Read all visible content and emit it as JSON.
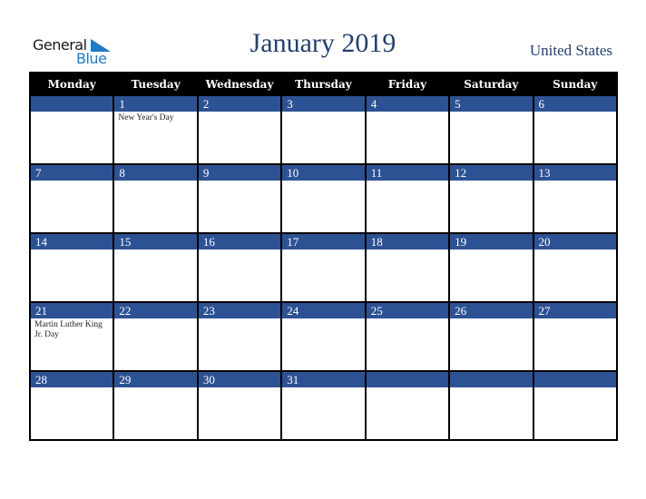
{
  "logo": {
    "word1": "General",
    "word2": "Blue",
    "accent": "#1f7ac8"
  },
  "header": {
    "title": "January 2019",
    "country": "United States"
  },
  "colors": {
    "band": "#2d5294",
    "header_bg": "#000000",
    "title": "#24406e"
  },
  "days": [
    "Monday",
    "Tuesday",
    "Wednesday",
    "Thursday",
    "Friday",
    "Saturday",
    "Sunday"
  ],
  "weeks": [
    [
      {
        "d": "",
        "h": ""
      },
      {
        "d": "1",
        "h": "New Year's Day"
      },
      {
        "d": "2",
        "h": ""
      },
      {
        "d": "3",
        "h": ""
      },
      {
        "d": "4",
        "h": ""
      },
      {
        "d": "5",
        "h": ""
      },
      {
        "d": "6",
        "h": ""
      }
    ],
    [
      {
        "d": "7",
        "h": ""
      },
      {
        "d": "8",
        "h": ""
      },
      {
        "d": "9",
        "h": ""
      },
      {
        "d": "10",
        "h": ""
      },
      {
        "d": "11",
        "h": ""
      },
      {
        "d": "12",
        "h": ""
      },
      {
        "d": "13",
        "h": ""
      }
    ],
    [
      {
        "d": "14",
        "h": ""
      },
      {
        "d": "15",
        "h": ""
      },
      {
        "d": "16",
        "h": ""
      },
      {
        "d": "17",
        "h": ""
      },
      {
        "d": "18",
        "h": ""
      },
      {
        "d": "19",
        "h": ""
      },
      {
        "d": "20",
        "h": ""
      }
    ],
    [
      {
        "d": "21",
        "h": "Martin Luther King Jr. Day"
      },
      {
        "d": "22",
        "h": ""
      },
      {
        "d": "23",
        "h": ""
      },
      {
        "d": "24",
        "h": ""
      },
      {
        "d": "25",
        "h": ""
      },
      {
        "d": "26",
        "h": ""
      },
      {
        "d": "27",
        "h": ""
      }
    ],
    [
      {
        "d": "28",
        "h": ""
      },
      {
        "d": "29",
        "h": ""
      },
      {
        "d": "30",
        "h": ""
      },
      {
        "d": "31",
        "h": ""
      },
      {
        "d": "",
        "h": ""
      },
      {
        "d": "",
        "h": ""
      },
      {
        "d": "",
        "h": ""
      }
    ]
  ]
}
